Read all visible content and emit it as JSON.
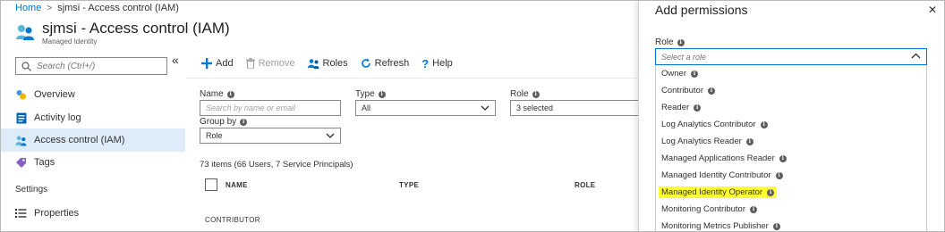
{
  "breadcrumb": {
    "home": "Home",
    "separator": ">",
    "current": "sjmsi - Access control (IAM)"
  },
  "header": {
    "title": "sjmsi - Access control (IAM)",
    "subtitle": "Managed Identity"
  },
  "sidebar": {
    "search_placeholder": "Search (Ctrl+/)",
    "collapse": "«",
    "items": [
      {
        "label": "Overview",
        "icon": "overview-icon"
      },
      {
        "label": "Activity log",
        "icon": "activity-log-icon"
      },
      {
        "label": "Access control (IAM)",
        "icon": "access-control-icon",
        "active": true
      },
      {
        "label": "Tags",
        "icon": "tag-icon"
      }
    ],
    "settings_label": "Settings",
    "settings_items": [
      {
        "label": "Properties",
        "icon": "properties-icon"
      }
    ]
  },
  "toolbar": {
    "add": "Add",
    "remove": "Remove",
    "roles": "Roles",
    "refresh": "Refresh",
    "help": "Help"
  },
  "filters": {
    "name_label": "Name",
    "name_placeholder": "Search by name or email",
    "type_label": "Type",
    "type_value": "All",
    "role_label": "Role",
    "role_value": "3 selected",
    "groupby_label": "Group by",
    "groupby_value": "Role"
  },
  "results": {
    "count": "73 items (66 Users, 7 Service Principals)",
    "columns": [
      "NAME",
      "TYPE",
      "ROLE"
    ],
    "group": "CONTRIBUTOR"
  },
  "panel": {
    "title": "Add permissions",
    "close": "✕",
    "role_label": "Role",
    "role_placeholder": "Select a role",
    "options": [
      {
        "label": "Owner"
      },
      {
        "label": "Contributor"
      },
      {
        "label": "Reader"
      },
      {
        "label": "Log Analytics Contributor"
      },
      {
        "label": "Log Analytics Reader"
      },
      {
        "label": "Managed Applications Reader"
      },
      {
        "label": "Managed Identity Contributor"
      },
      {
        "label": "Managed Identity Operator",
        "highlighted": true
      },
      {
        "label": "Monitoring Contributor"
      },
      {
        "label": "Monitoring Metrics Publisher"
      }
    ]
  },
  "colors": {
    "accent": "#0078d4",
    "highlight": "#ffff33",
    "active_bg": "#deecf9"
  }
}
